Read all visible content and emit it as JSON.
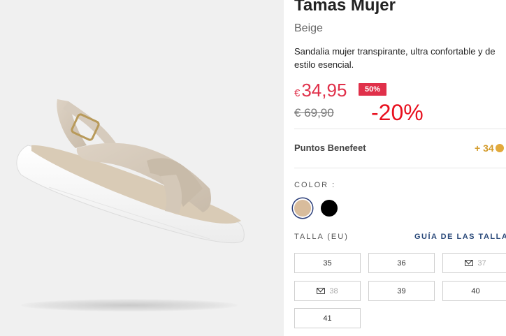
{
  "product": {
    "title": "Tamas Mujer",
    "color_name": "Beige",
    "description": "Sandalia mujer transpirante, ultra confortable y de estilo esencial."
  },
  "pricing": {
    "currency": "€",
    "price": "34,95",
    "badge": "50%",
    "old_price": "€ 69,90",
    "discount_overlay": "-20%"
  },
  "points": {
    "label": "Puntos Benefeet",
    "value": "+ 34"
  },
  "colors": {
    "label": "COLOR :",
    "swatches": [
      {
        "name": "beige",
        "hex": "#d8bc9c",
        "selected": true
      },
      {
        "name": "black",
        "hex": "#000000",
        "selected": false
      }
    ]
  },
  "sizes": {
    "label": "TALLA (EU)",
    "guide": "GUÍA DE LAS TALLA",
    "items": [
      {
        "value": "35",
        "available": true
      },
      {
        "value": "36",
        "available": true
      },
      {
        "value": "37",
        "available": false,
        "icon": "mail-icon"
      },
      {
        "value": "38",
        "available": false,
        "icon": "mail-icon"
      },
      {
        "value": "39",
        "available": true
      },
      {
        "value": "40",
        "available": true
      },
      {
        "value": "41",
        "available": true
      }
    ]
  },
  "theme": {
    "accent": "#e0304a",
    "link": "#2b4a7a",
    "points": "#d39a28"
  }
}
